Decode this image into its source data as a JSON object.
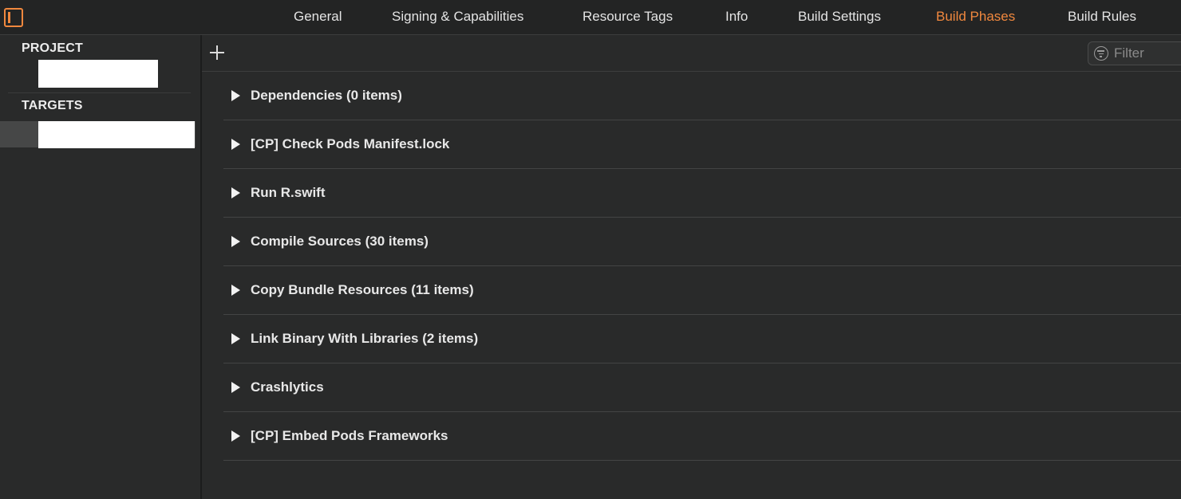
{
  "tabs": [
    {
      "label": "General",
      "active": false
    },
    {
      "label": "Signing & Capabilities",
      "active": false
    },
    {
      "label": "Resource Tags",
      "active": false
    },
    {
      "label": "Info",
      "active": false
    },
    {
      "label": "Build Settings",
      "active": false
    },
    {
      "label": "Build Phases",
      "active": true
    },
    {
      "label": "Build Rules",
      "active": false
    }
  ],
  "sidebar": {
    "project_header": "PROJECT",
    "targets_header": "TARGETS"
  },
  "filter": {
    "placeholder": "Filter",
    "value": ""
  },
  "phases": [
    {
      "label": "Dependencies (0 items)"
    },
    {
      "label": "[CP] Check Pods Manifest.lock"
    },
    {
      "label": "Run R.swift"
    },
    {
      "label": "Compile Sources (30 items)"
    },
    {
      "label": "Copy Bundle Resources (11 items)"
    },
    {
      "label": "Link Binary With Libraries (2 items)"
    },
    {
      "label": "Crashlytics"
    },
    {
      "label": "[CP] Embed Pods Frameworks"
    }
  ],
  "colors": {
    "accent": "#f0883e",
    "background": "#292a2a",
    "text": "#e6e6e6"
  },
  "icons": {
    "panel_toggle": "sidebar-toggle-icon",
    "add": "plus-icon",
    "filter": "filter-icon",
    "disclosure": "disclosure-triangle-right-icon"
  }
}
